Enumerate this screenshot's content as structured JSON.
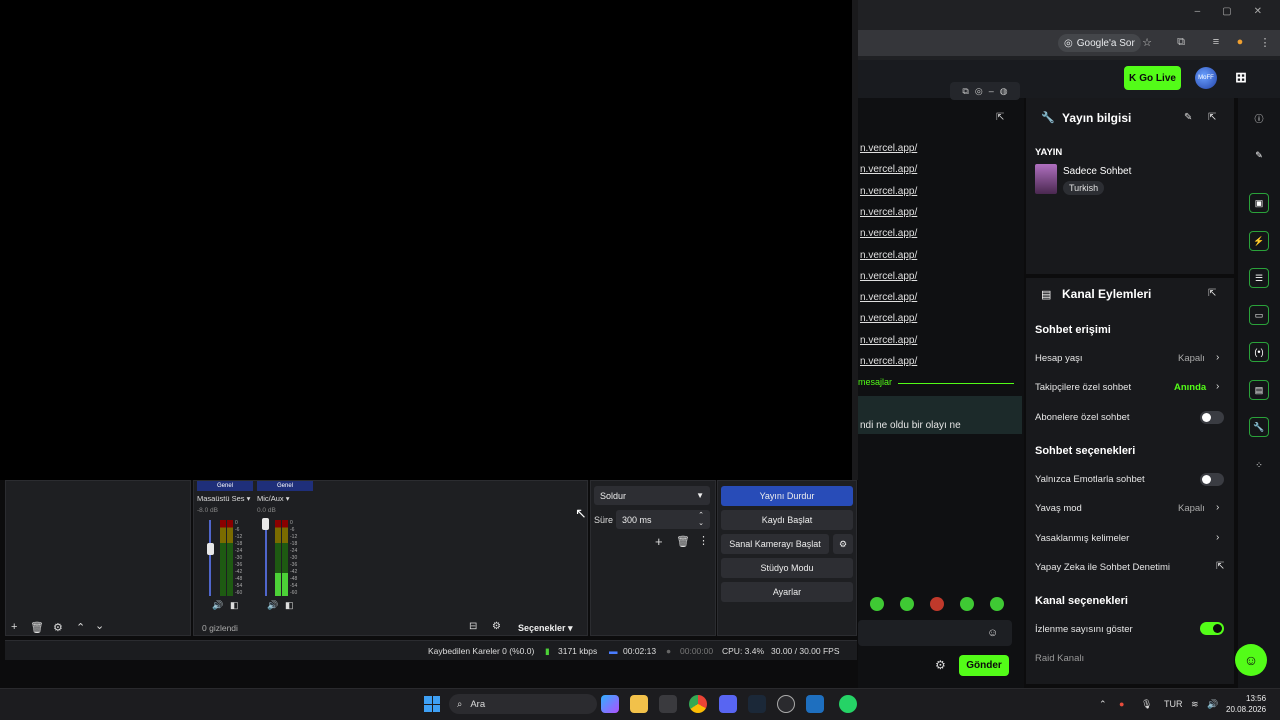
{
  "browser": {
    "google_chip": "Google'a Sor",
    "window_controls": [
      "–",
      "▢",
      "✕"
    ]
  },
  "kick": {
    "go_live": "Go Live",
    "avatar_text": "MoFF",
    "chat_links": [
      "n.vercel.app/",
      "n.vercel.app/",
      "n.vercel.app/",
      "n.vercel.app/",
      "n.vercel.app/",
      "n.vercel.app/",
      "n.vercel.app/",
      "n.vercel.app/",
      "n.vercel.app/",
      "n.vercel.app/",
      "n.vercel.app/"
    ],
    "new_messages": "mesajlar",
    "chat_message": "ndi ne oldu bir olayı ne",
    "send_button": "Gönder",
    "info_panel": {
      "title": "Yayın bilgisi",
      "section": "YAYIN",
      "stream_title": "Sadece Sohbet",
      "language": "Turkish"
    },
    "actions_panel": {
      "title": "Kanal Eylemleri",
      "chat_access_title": "Sohbet erişimi",
      "account_age_label": "Hesap yaşı",
      "account_age_value": "Kapalı",
      "followers_only_label": "Takipçilere özel sohbet",
      "followers_only_value": "Anında",
      "subscribers_only_label": "Abonelere özel sohbet",
      "chat_options_title": "Sohbet seçenekleri",
      "emotes_only_label": "Yalnızca Emotlarla sohbet",
      "slow_mode_label": "Yavaş mod",
      "slow_mode_value": "Kapalı",
      "banned_words_label": "Yasaklanmış kelimeler",
      "ai_moderation_label": "Yapay Zeka ile Sohbet Denetimi",
      "channel_options_title": "Kanal seçenekleri",
      "show_viewers_label": "İzlenme sayısını göster",
      "raid_label": "Raid Kanalı"
    }
  },
  "obs": {
    "mixer": {
      "channels": [
        {
          "tag": "Genel",
          "name": "Masaüstü Ses",
          "db": "-8.0 dB",
          "level": 0.0,
          "fader": 0.62
        },
        {
          "tag": "Genel",
          "name": "Mic/Aux",
          "db": "0.0 dB",
          "level": 0.3,
          "fader": 0.95
        }
      ],
      "scale": [
        "0",
        "-6",
        "-12",
        "-18",
        "-24",
        "-30",
        "-36",
        "-42",
        "-48",
        "-54",
        "-60"
      ],
      "hidden_count": "0 gizlendi",
      "options_label": "Seçenekler"
    },
    "transition": {
      "type": "Soldur",
      "duration_label": "Süre",
      "duration_value": "300 ms"
    },
    "controls": {
      "stop_stream": "Yayını Durdur",
      "start_record": "Kaydı Başlat",
      "virtual_cam": "Sanal Kamerayı Başlat",
      "studio_mode": "Stüdyo Modu",
      "settings": "Ayarlar"
    },
    "status": {
      "dropped_frames": "Kaybedilen Kareler 0 (%0.0)",
      "bitrate": "3171 kbps",
      "stream_time": "00:02:13",
      "record_time": "00:00:00",
      "cpu": "CPU: 3.4%",
      "fps": "30.00 / 30.00 FPS"
    }
  },
  "taskbar": {
    "search": "Ara",
    "lang": "TUR",
    "time": "13:56",
    "date": "20.08.2026"
  },
  "colors": {
    "kick_green": "#53fc18",
    "obs_blue": "#284cb8"
  }
}
